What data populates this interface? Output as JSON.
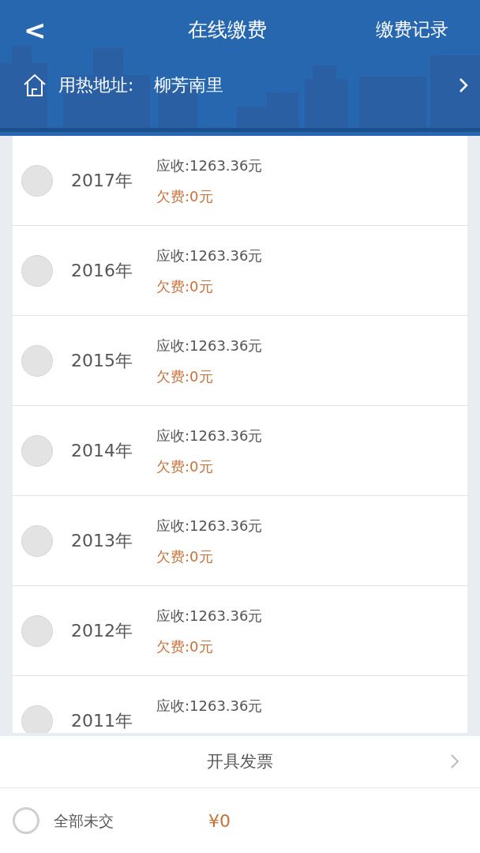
{
  "header": {
    "back": "<",
    "title": "在线缴费",
    "action": "缴费记录"
  },
  "address": {
    "label": "用热地址:",
    "value": "柳芳南里"
  },
  "bills": [
    {
      "year": "2017年",
      "receivable": "应收:1263.36元",
      "owed": "欠费:0元",
      "checked": false
    },
    {
      "year": "2016年",
      "receivable": "应收:1263.36元",
      "owed": "欠费:0元",
      "checked": false
    },
    {
      "year": "2015年",
      "receivable": "应收:1263.36元",
      "owed": "欠费:0元",
      "checked": false
    },
    {
      "year": "2014年",
      "receivable": "应收:1263.36元",
      "owed": "欠费:0元",
      "checked": false
    },
    {
      "year": "2013年",
      "receivable": "应收:1263.36元",
      "owed": "欠费:0元",
      "checked": false
    },
    {
      "year": "2012年",
      "receivable": "应收:1263.36元",
      "owed": "欠费:0元",
      "checked": false
    },
    {
      "year": "2011年",
      "receivable": "应收:1263.36元",
      "checked": false
    }
  ],
  "invoice": {
    "label": "开具发票"
  },
  "footer": {
    "select_all": {
      "label": "全部未交",
      "checked": false
    },
    "total": "¥0"
  }
}
